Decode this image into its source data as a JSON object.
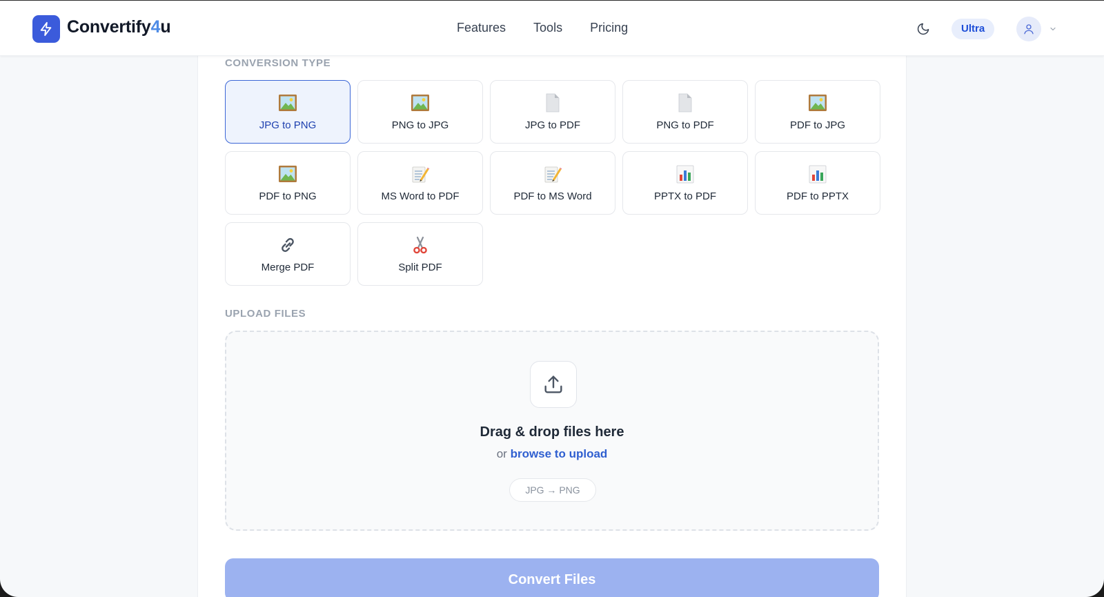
{
  "header": {
    "brand_prefix": "Convertify",
    "brand_accent": "4",
    "brand_suffix": "u",
    "nav": [
      "Features",
      "Tools",
      "Pricing"
    ],
    "plan_badge": "Ultra"
  },
  "conversion": {
    "section_label": "CONVERSION TYPE",
    "selected_index": 0,
    "types": [
      {
        "label": "JPG to PNG",
        "icon": "picture-icon"
      },
      {
        "label": "PNG to JPG",
        "icon": "picture-icon"
      },
      {
        "label": "JPG to PDF",
        "icon": "page-icon"
      },
      {
        "label": "PNG to PDF",
        "icon": "page-icon"
      },
      {
        "label": "PDF to JPG",
        "icon": "picture-icon"
      },
      {
        "label": "PDF to PNG",
        "icon": "picture-icon"
      },
      {
        "label": "MS Word to PDF",
        "icon": "memo-icon"
      },
      {
        "label": "PDF to MS Word",
        "icon": "memo-icon"
      },
      {
        "label": "PPTX to PDF",
        "icon": "bar-chart-icon"
      },
      {
        "label": "PDF to PPTX",
        "icon": "bar-chart-icon"
      },
      {
        "label": "Merge PDF",
        "icon": "link-icon"
      },
      {
        "label": "Split PDF",
        "icon": "scissors-icon"
      }
    ]
  },
  "upload": {
    "section_label": "UPLOAD FILES",
    "title": "Drag & drop files here",
    "or_text": "or",
    "browse_text": "browse to upload",
    "format_pill": "JPG → PNG"
  },
  "convert_button": "Convert Files",
  "colors": {
    "brand": "#3b5bdb",
    "selected_border": "#3b66d6",
    "button_disabled": "#9cb2f0"
  }
}
